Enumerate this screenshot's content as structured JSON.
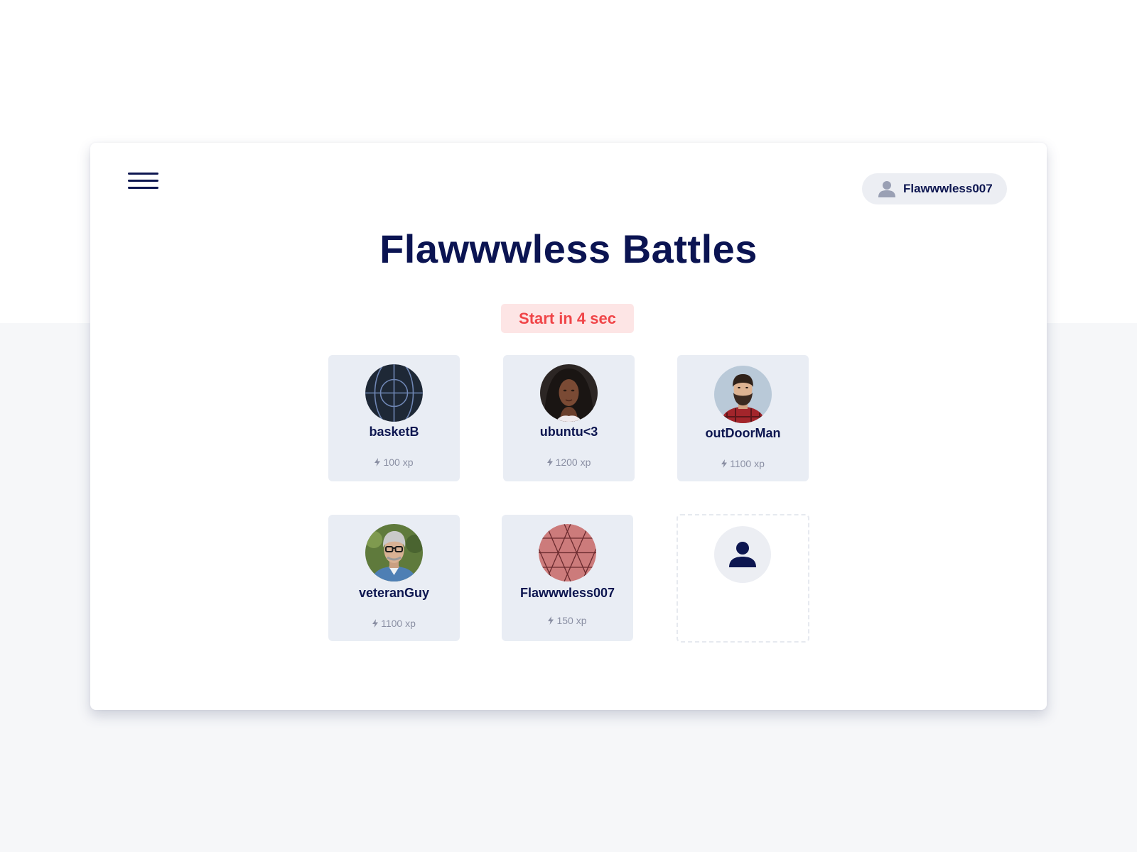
{
  "header": {
    "menu_icon": "hamburger-menu-icon",
    "user": {
      "icon": "user-icon",
      "name": "Flawwwless007"
    }
  },
  "title": "Flawwwless Battles",
  "countdown": "Start in 4 sec",
  "colors": {
    "title": "#0b1452",
    "countdown_text": "#f04548",
    "countdown_bg": "#fde5e5",
    "card_bg": "#e9edf4",
    "xp_text": "#8a8fa3"
  },
  "players": [
    {
      "name": "basketB",
      "xp": "100 xp",
      "avatar": "basketball-avatar"
    },
    {
      "name": "ubuntu<3",
      "xp": "1200 xp",
      "avatar": "woman-photo-avatar"
    },
    {
      "name": "outDoorMan",
      "xp": "1100 xp",
      "avatar": "bearded-man-photo-avatar"
    },
    {
      "name": "veteranGuy",
      "xp": "1100 xp",
      "avatar": "older-man-glasses-photo-avatar"
    },
    {
      "name": "Flawwwless007",
      "xp": "150 xp",
      "avatar": "pattern-avatar"
    }
  ],
  "empty_slot": {
    "icon": "user-placeholder-icon"
  }
}
